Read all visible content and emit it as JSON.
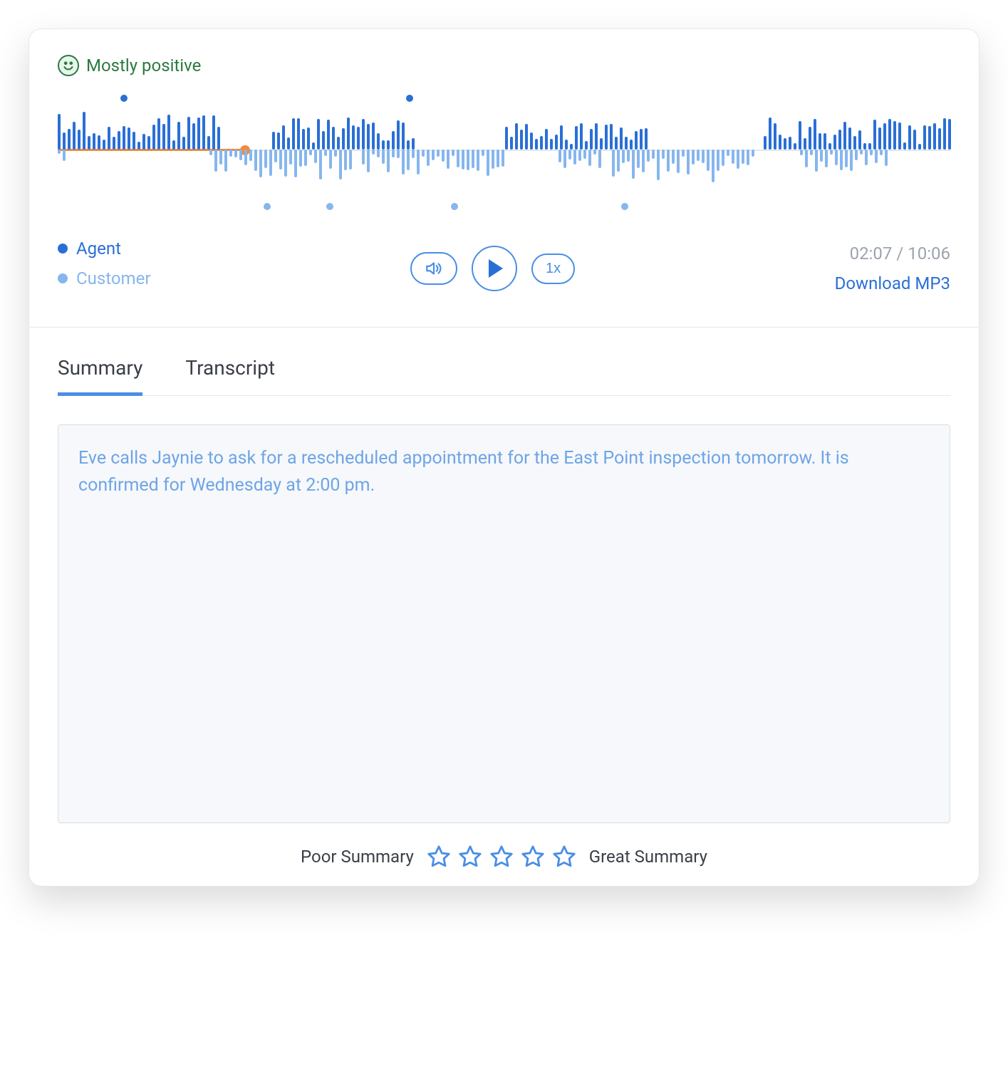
{
  "sentiment": {
    "label": "Mostly positive"
  },
  "player": {
    "position": "02:07",
    "duration": "10:06",
    "progress_pct": 21,
    "speed_label": "1x",
    "download_label": "Download MP3"
  },
  "legend": {
    "agent": "Agent",
    "customer": "Customer"
  },
  "tabs": {
    "summary": "Summary",
    "transcript": "Transcript",
    "active": "summary"
  },
  "summary": {
    "text": "Eve calls Jaynie to ask for a rescheduled appointment for the East Point inspection tomorrow.  It is confirmed for Wednesday at 2:00 pm."
  },
  "rating": {
    "poor_label": "Poor Summary",
    "great_label": "Great Summary",
    "value": 0,
    "max": 5
  },
  "colors": {
    "agent": "#2a6fd6",
    "customer": "#86b6ee",
    "progress": "#f08a3c",
    "sentiment": "#2b7a3f"
  },
  "waveform": {
    "agent_markers_pct": [
      7,
      39
    ],
    "customer_markers_pct": [
      23,
      30,
      44,
      63
    ],
    "agent_segments": [
      {
        "start": 0,
        "end": 18,
        "intensity": 0.7
      },
      {
        "start": 24,
        "end": 40,
        "intensity": 0.6
      },
      {
        "start": 50,
        "end": 66,
        "intensity": 0.55
      },
      {
        "start": 79,
        "end": 100,
        "intensity": 0.6
      }
    ],
    "customer_segments": [
      {
        "start": 0,
        "end": 1,
        "intensity": 0.3
      },
      {
        "start": 17,
        "end": 33,
        "intensity": 0.55
      },
      {
        "start": 34,
        "end": 50,
        "intensity": 0.5
      },
      {
        "start": 56,
        "end": 61,
        "intensity": 0.35
      },
      {
        "start": 62,
        "end": 78,
        "intensity": 0.6
      },
      {
        "start": 83,
        "end": 93,
        "intensity": 0.45
      }
    ]
  }
}
